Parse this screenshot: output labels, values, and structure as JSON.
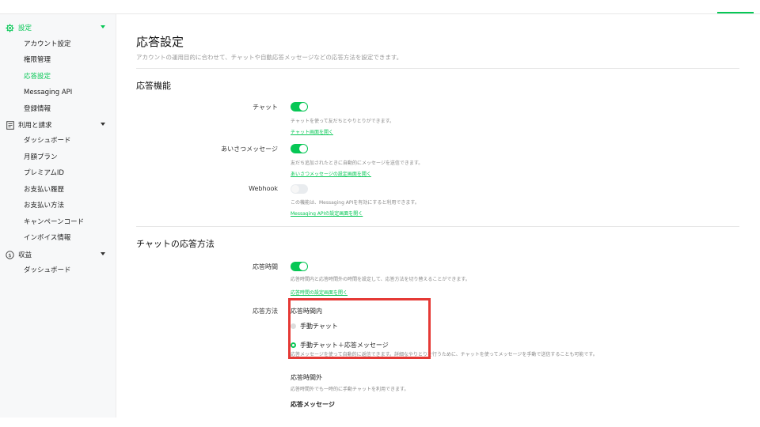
{
  "colors": {
    "accent": "#06c755",
    "highlight": "#e53935"
  },
  "sidebar": {
    "groups": [
      {
        "label": "設定",
        "icon": "gear-icon",
        "items": [
          "アカウント設定",
          "権限管理",
          "応答設定",
          "Messaging API",
          "登録情報"
        ]
      },
      {
        "label": "利用と請求",
        "icon": "receipt-icon",
        "items": [
          "ダッシュボード",
          "月額プラン",
          "プレミアムID",
          "お支払い履歴",
          "お支払い方法",
          "キャンペーンコード",
          "インボイス情報"
        ]
      },
      {
        "label": "収益",
        "icon": "currency-icon",
        "items": [
          "ダッシュボード"
        ]
      }
    ],
    "active_item": "応答設定"
  },
  "page": {
    "title": "応答設定",
    "subtitle": "アカウントの運用目的に合わせて、チャットや自動応答メッセージなどの応答方法を設定できます。"
  },
  "features": {
    "title": "応答機能",
    "chat": {
      "label": "チャット",
      "enabled": true,
      "desc": "チャットを使って友だちとやりとりができます。",
      "link": "チャット画面を開く"
    },
    "greeting": {
      "label": "あいさつメッセージ",
      "enabled": true,
      "desc": "友だち追加されたときに自動的にメッセージを送信できます。",
      "link": "あいさつメッセージの設定画面を開く"
    },
    "webhook": {
      "label": "Webhook",
      "enabled": false,
      "desc": "この機能は、Messaging APIを有効にすると利用できます。",
      "link": "Messaging APIの設定画面を開く"
    }
  },
  "chat_method": {
    "title": "チャットの応答方法",
    "hours": {
      "label": "応答時間",
      "enabled": true,
      "desc": "応答時間内と応答時間外の時間を設定して、応答方法を切り替えることができます。",
      "link": "応答時間の設定画面を開く"
    },
    "method": {
      "label": "応答方法",
      "within_hours": {
        "title": "応答時間内",
        "options": [
          {
            "label": "手動チャット",
            "checked": false
          },
          {
            "label": "手動チャット＋応答メッセージ",
            "checked": true,
            "desc": "応答メッセージを使って自動的に返信できます。詳細なやりとりを行うために、チャットを使ってメッセージを手動で送信することも可能です。"
          }
        ]
      },
      "outside_hours": {
        "title": "応答時間外",
        "desc": "応答時間外でも一時的に手動チャットを利用できます。"
      },
      "response_message_title": "応答メッセージ"
    }
  }
}
